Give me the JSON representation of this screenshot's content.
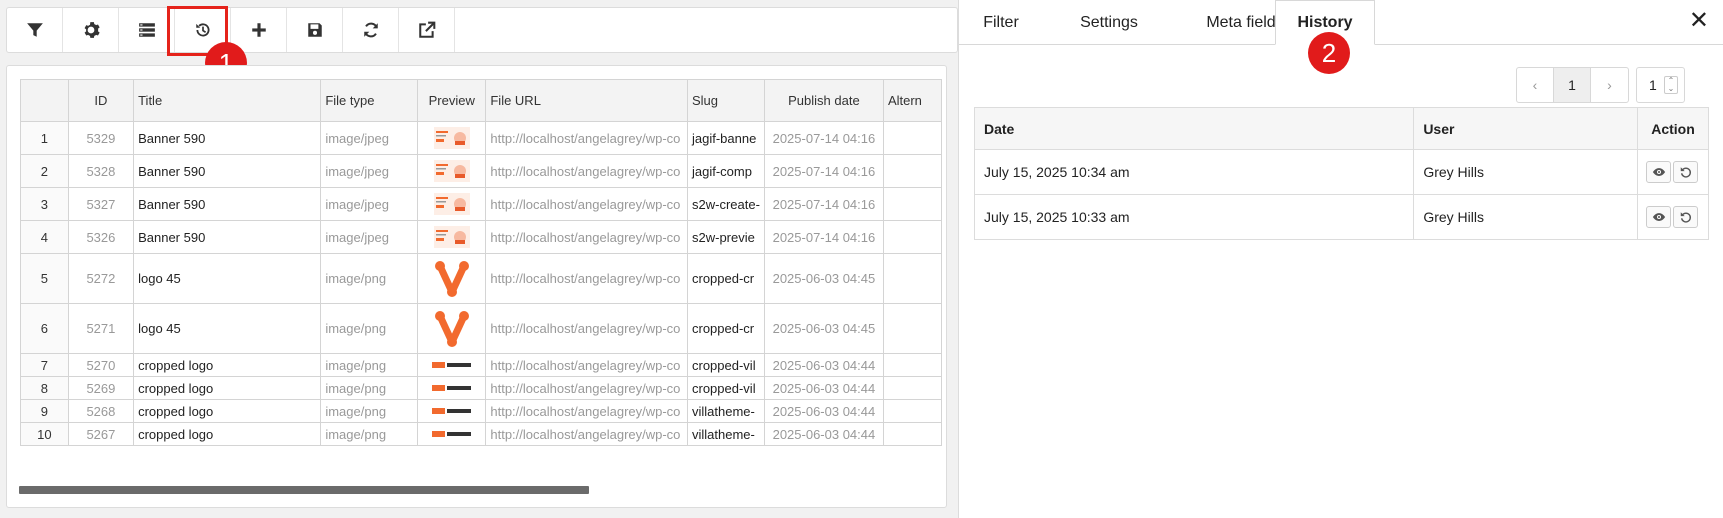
{
  "toolbar": {
    "buttons": [
      {
        "name": "filter-button",
        "icon": "filter-icon"
      },
      {
        "name": "settings-button",
        "icon": "gear-icon"
      },
      {
        "name": "columns-button",
        "icon": "list-icon"
      },
      {
        "name": "history-button",
        "icon": "history-icon"
      },
      {
        "name": "add-button",
        "icon": "plus-icon"
      },
      {
        "name": "save-button",
        "icon": "save-icon"
      },
      {
        "name": "reload-button",
        "icon": "refresh-icon"
      },
      {
        "name": "open-external-button",
        "icon": "external-link-icon"
      }
    ]
  },
  "annotations": {
    "badge1": "1",
    "badge2": "2"
  },
  "grid": {
    "headers": [
      "",
      "ID",
      "Title",
      "File type",
      "Preview",
      "File URL",
      "Slug",
      "Publish date",
      "Altern"
    ],
    "rows": [
      {
        "n": "1",
        "id": "5329",
        "title": "Banner 590",
        "type": "image/jpeg",
        "preview": "banner",
        "url": "http://localhost/angelagrey/wp-co",
        "slug": "jagif-banne",
        "date": "2025-07-14 04:16"
      },
      {
        "n": "2",
        "id": "5328",
        "title": "Banner 590",
        "type": "image/jpeg",
        "preview": "banner",
        "url": "http://localhost/angelagrey/wp-co",
        "slug": "jagif-comp",
        "date": "2025-07-14 04:16"
      },
      {
        "n": "3",
        "id": "5327",
        "title": "Banner 590",
        "type": "image/jpeg",
        "preview": "banner",
        "url": "http://localhost/angelagrey/wp-co",
        "slug": "s2w-create-",
        "date": "2025-07-14 04:16"
      },
      {
        "n": "4",
        "id": "5326",
        "title": "Banner 590",
        "type": "image/jpeg",
        "preview": "banner",
        "url": "http://localhost/angelagrey/wp-co",
        "slug": "s2w-previe",
        "date": "2025-07-14 04:16"
      },
      {
        "n": "5",
        "id": "5272",
        "title": "logo 45",
        "type": "image/png",
        "preview": "logo-v",
        "url": "http://localhost/angelagrey/wp-co",
        "slug": "cropped-cr",
        "date": "2025-06-03 04:45"
      },
      {
        "n": "6",
        "id": "5271",
        "title": "logo 45",
        "type": "image/png",
        "preview": "logo-v",
        "url": "http://localhost/angelagrey/wp-co",
        "slug": "cropped-cr",
        "date": "2025-06-03 04:45"
      },
      {
        "n": "7",
        "id": "5270",
        "title": "cropped logo",
        "type": "image/png",
        "preview": "villatheme",
        "url": "http://localhost/angelagrey/wp-co",
        "slug": "cropped-vil",
        "date": "2025-06-03 04:44"
      },
      {
        "n": "8",
        "id": "5269",
        "title": "cropped logo",
        "type": "image/png",
        "preview": "villatheme",
        "url": "http://localhost/angelagrey/wp-co",
        "slug": "cropped-vil",
        "date": "2025-06-03 04:44"
      },
      {
        "n": "9",
        "id": "5268",
        "title": "cropped logo",
        "type": "image/png",
        "preview": "villatheme",
        "url": "http://localhost/angelagrey/wp-co",
        "slug": "villatheme-",
        "date": "2025-06-03 04:44"
      },
      {
        "n": "10",
        "id": "5267",
        "title": "cropped logo",
        "type": "image/png",
        "preview": "villatheme",
        "url": "http://localhost/angelagrey/wp-co",
        "slug": "villatheme-",
        "date": "2025-06-03 04:44"
      }
    ]
  },
  "panel": {
    "tabs": [
      "Filter",
      "Settings",
      "Meta fields",
      "History"
    ],
    "active_tab": "History",
    "close": "✕",
    "pager": {
      "prev": "‹",
      "current": "1",
      "next": "›",
      "page_select": "1"
    },
    "history": {
      "headers": [
        "Date",
        "User",
        "Action"
      ],
      "rows": [
        {
          "date": "July 15, 2025 10:34 am",
          "user": "Grey Hills"
        },
        {
          "date": "July 15, 2025 10:33 am",
          "user": "Grey Hills"
        }
      ]
    }
  },
  "colors": {
    "highlight": "#e5231b",
    "badge": "#e11b1b",
    "logo_orange": "#f26a2e"
  }
}
